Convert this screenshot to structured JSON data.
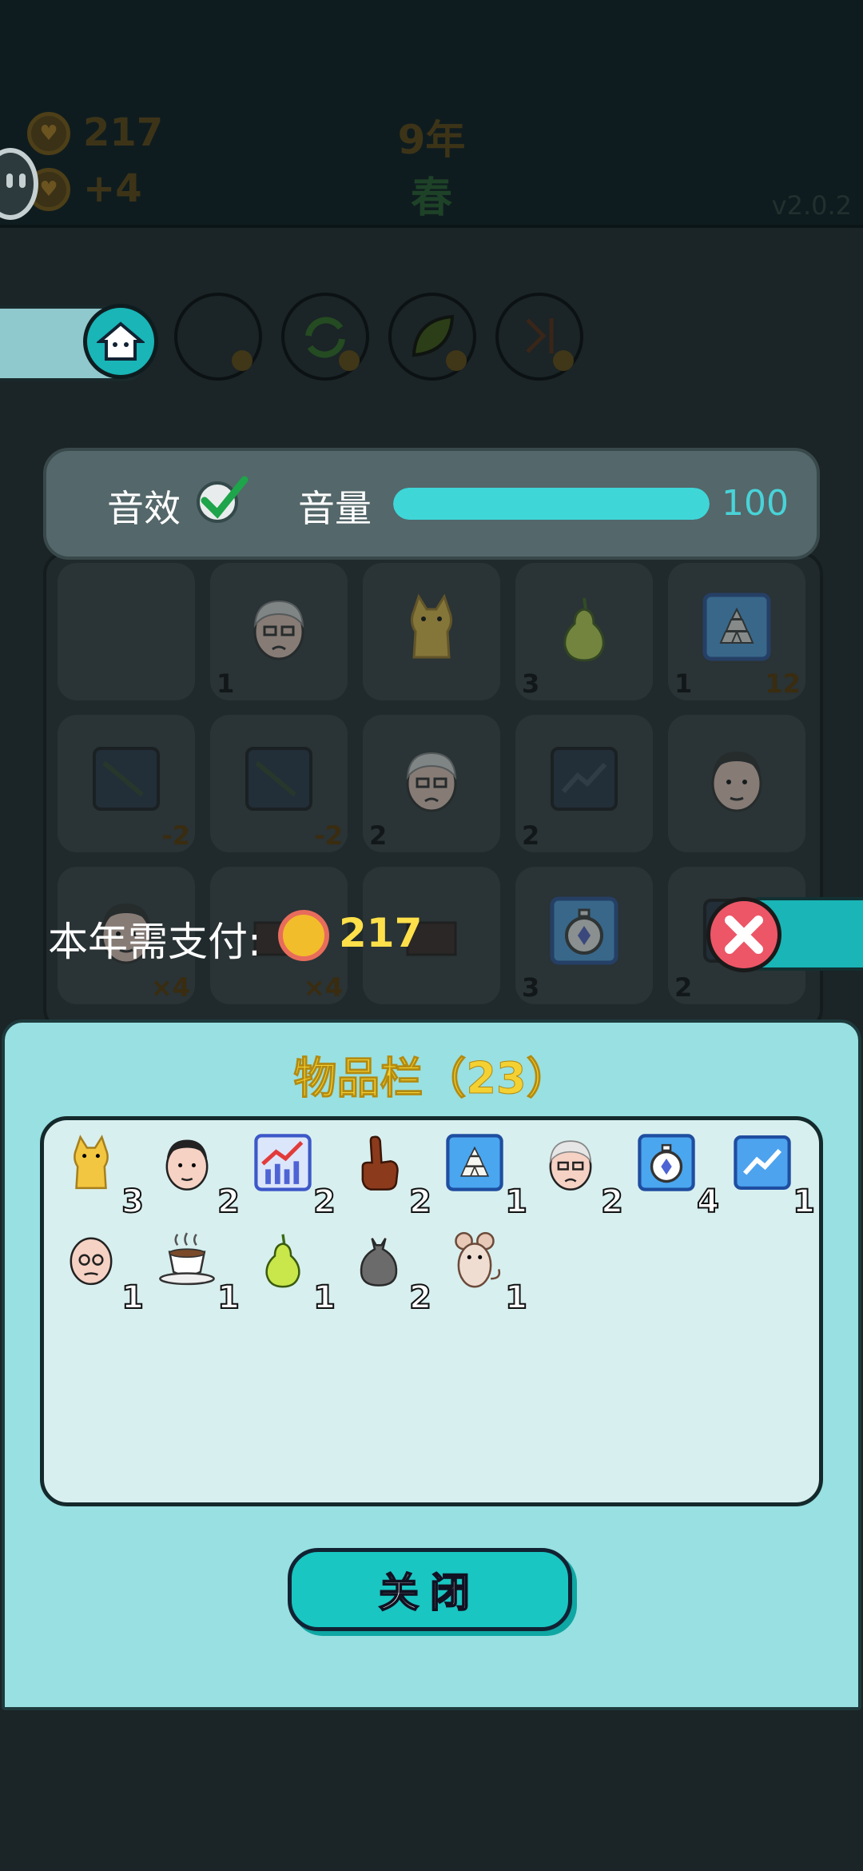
{
  "hud": {
    "coins": "217",
    "income": "+4",
    "year": "9年",
    "season": "春",
    "version": "v2.0.2"
  },
  "settings": {
    "sfx_label": "音效",
    "sfx_enabled": true,
    "volume_label": "音量",
    "volume_value": "100",
    "volume_fraction": 1.0
  },
  "tools": [
    {
      "icon": "home-icon"
    },
    {
      "icon": "blocks-icon"
    },
    {
      "icon": "refresh-icon"
    },
    {
      "icon": "leaf-icon"
    },
    {
      "icon": "skip-icon"
    }
  ],
  "board": {
    "cells": [
      {
        "icon": "empty",
        "count": ""
      },
      {
        "icon": "old-man-icon",
        "count": "1",
        "extra": ""
      },
      {
        "icon": "cat-icon",
        "count": "",
        "extra": ""
      },
      {
        "icon": "pear-icon",
        "count": "3",
        "extra": ""
      },
      {
        "icon": "gold-bars-icon",
        "count": "1",
        "extra": "12"
      },
      {
        "icon": "chart-down-icon",
        "count": "",
        "extra": "-2"
      },
      {
        "icon": "chart-down-icon",
        "count": "",
        "extra": "-2"
      },
      {
        "icon": "old-man-icon",
        "count": "2",
        "extra": ""
      },
      {
        "icon": "chart-up-icon",
        "count": "2",
        "extra": ""
      },
      {
        "icon": "man-face-icon",
        "count": "",
        "extra": ""
      },
      {
        "icon": "man-face-icon",
        "count": "",
        "extra": "×4"
      },
      {
        "icon": "hand-icon",
        "count": "",
        "extra": "×4"
      },
      {
        "icon": "hand-icon",
        "count": "",
        "extra": ""
      },
      {
        "icon": "timer-icon",
        "count": "3",
        "extra": ""
      },
      {
        "icon": "chart-up-icon",
        "count": "2",
        "extra": ""
      }
    ]
  },
  "payment": {
    "label": "本年需支付:",
    "amount": "217"
  },
  "inventory": {
    "title": "物品栏（23）",
    "items": [
      {
        "icon": "cat-icon",
        "count": "3"
      },
      {
        "icon": "man-face-icon",
        "count": "2"
      },
      {
        "icon": "chart-rising-icon",
        "count": "2"
      },
      {
        "icon": "pointing-hand-icon",
        "count": "2"
      },
      {
        "icon": "gold-bars-icon",
        "count": "1"
      },
      {
        "icon": "old-man-icon",
        "count": "2"
      },
      {
        "icon": "timer-icon",
        "count": "4"
      },
      {
        "icon": "chart-line-icon",
        "count": "1"
      },
      {
        "icon": "bald-man-icon",
        "count": "1"
      },
      {
        "icon": "coffee-cup-icon",
        "count": "1"
      },
      {
        "icon": "pear-icon",
        "count": "1"
      },
      {
        "icon": "garbage-bag-icon",
        "count": "2"
      },
      {
        "icon": "mouse-icon",
        "count": "1"
      }
    ],
    "close_label": "关闭"
  },
  "colors": {
    "accent": "#19c6c2",
    "panel": "#98e0e2",
    "title": "#f4d132",
    "coin": "#f2bd2a",
    "cancel": "#ec5667"
  }
}
